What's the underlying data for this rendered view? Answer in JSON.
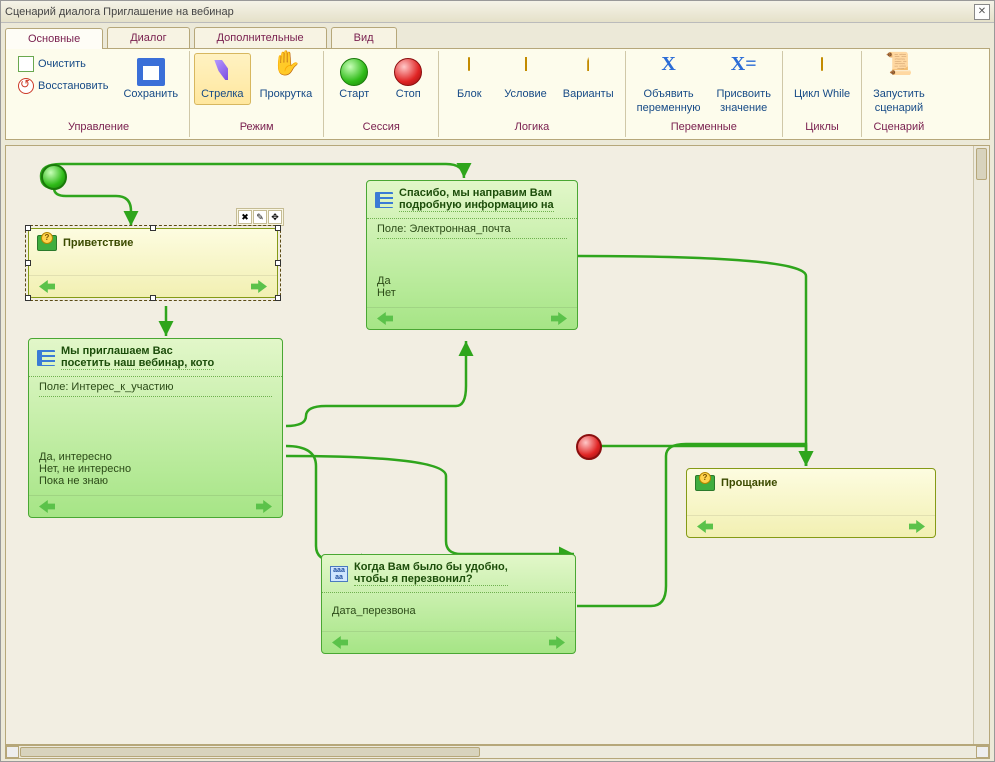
{
  "window": {
    "title": "Сценарий диалога Приглашение на вебинар"
  },
  "tabs": [
    {
      "label": "Основные",
      "active": true
    },
    {
      "label": "Диалог",
      "active": false
    },
    {
      "label": "Дополнительные",
      "active": false
    },
    {
      "label": "Вид",
      "active": false
    }
  ],
  "ribbon": {
    "groups": {
      "management": {
        "label": "Управление",
        "clear": "Очистить",
        "restore": "Восстановить",
        "save": "Сохранить"
      },
      "mode": {
        "label": "Режим",
        "arrow": "Стрелка",
        "scroll": "Прокрутка"
      },
      "session": {
        "label": "Сессия",
        "start": "Старт",
        "stop": "Стоп"
      },
      "logic": {
        "label": "Логика",
        "block": "Блок",
        "cond": "Условие",
        "variants": "Варианты"
      },
      "vars": {
        "label": "Переменные",
        "declare1": "Объявить",
        "declare2": "переменную",
        "assign1": "Присвоить",
        "assign2": "значение"
      },
      "loops": {
        "label": "Циклы",
        "while": "Цикл While"
      },
      "scenario": {
        "label": "Сценарий",
        "run1": "Запустить",
        "run2": "сценарий"
      }
    }
  },
  "nodes": {
    "greet": {
      "title": "Приветствие"
    },
    "invite": {
      "title1": "Мы приглашаем Вас",
      "title2": "посетить наш вебинар, кото",
      "field": "Поле: Интерес_к_участию",
      "opt1": "Да, интересно",
      "opt2": "Нет, не интересно",
      "opt3": "Пока не знаю"
    },
    "thanks": {
      "title1": "Спасибо, мы направим Вам",
      "title2": "подробную информацию на",
      "field": "Поле: Электронная_почта",
      "opt1": "Да",
      "opt2": "Нет"
    },
    "callback": {
      "title1": "Когда Вам было бы удобно,",
      "title2": "чтобы я перезвонил?",
      "opt1": "Дата_перезвона"
    },
    "bye": {
      "title": "Прощание"
    }
  }
}
